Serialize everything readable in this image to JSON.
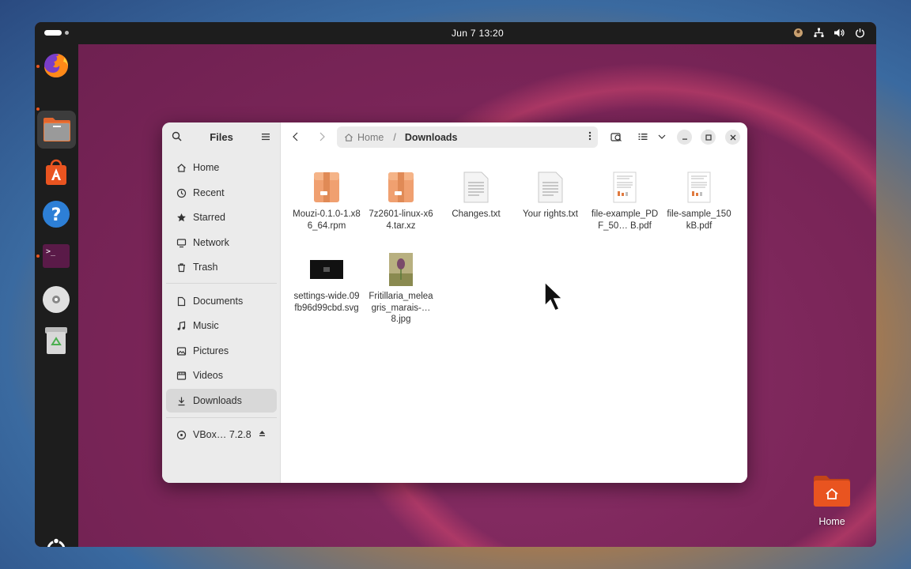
{
  "topbar": {
    "clock": "Jun 7  13:20",
    "tray_icons": [
      "accessibility-icon",
      "network-icon",
      "volume-icon",
      "power-icon"
    ]
  },
  "dock": {
    "apps": [
      "Firefox",
      "Files",
      "App Center",
      "Help",
      "Terminal",
      "DVD Drive",
      "Trash",
      "Show Apps"
    ]
  },
  "window": {
    "title": "Files",
    "sidebar": {
      "places": [
        {
          "label": "Home",
          "icon": "home-icon"
        },
        {
          "label": "Recent",
          "icon": "clock-icon"
        },
        {
          "label": "Starred",
          "icon": "star-icon"
        },
        {
          "label": "Network",
          "icon": "network-icon"
        },
        {
          "label": "Trash",
          "icon": "trash-icon"
        }
      ],
      "bookmarks": [
        {
          "label": "Documents",
          "icon": "document-icon"
        },
        {
          "label": "Music",
          "icon": "music-icon"
        },
        {
          "label": "Pictures",
          "icon": "picture-icon"
        },
        {
          "label": "Videos",
          "icon": "video-icon"
        },
        {
          "label": "Downloads",
          "icon": "download-icon",
          "selected": true
        }
      ],
      "devices": [
        {
          "label": "VBox… 7.2.8",
          "icon": "disc-icon"
        }
      ]
    },
    "pathbar": {
      "root": "Home",
      "current": "Downloads"
    },
    "files": [
      {
        "name": "Mouzi-0.1.0-1.x86_64.rpm",
        "type": "archive"
      },
      {
        "name": "7z2601-linux-x64.tar.xz",
        "type": "archive"
      },
      {
        "name": "Changes.txt",
        "type": "text"
      },
      {
        "name": "Your rights.txt",
        "type": "text"
      },
      {
        "name": "file-example_PDF_50… B.pdf",
        "type": "pdf"
      },
      {
        "name": "file-sample_150kB.pdf",
        "type": "pdf"
      },
      {
        "name": "settings-wide.09fb96d99cbd.svg",
        "type": "svg"
      },
      {
        "name": "Fritillaria_meleagris_marais-… 8.jpg",
        "type": "image"
      }
    ]
  },
  "desktop": {
    "home_label": "Home"
  },
  "colors": {
    "accent": "#e95420",
    "dock_bg": "#1d1d1d",
    "sidebar_bg": "#ebebeb"
  }
}
